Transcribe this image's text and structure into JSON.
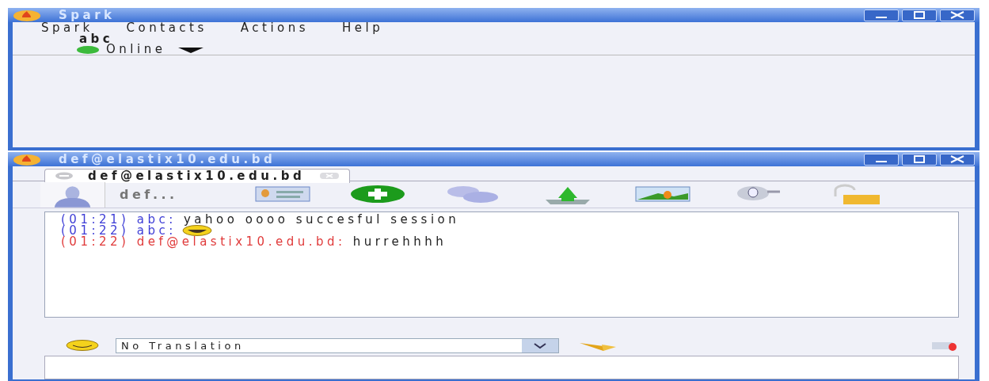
{
  "main_window": {
    "title": "Spark",
    "menu": [
      "Spark",
      "Contacts",
      "Actions",
      "Help"
    ],
    "user": {
      "name": "abc",
      "status": "Online",
      "online": true
    }
  },
  "chat_window": {
    "title": "def@elastix10.edu.bd",
    "tabs": [
      {
        "label": "def@elastix10.edu.bd",
        "selected": true
      }
    ],
    "contact_name": "def...",
    "messages": [
      {
        "time": "(01:21)",
        "sender": "abc:",
        "text": "yahoo oooo  succesful session",
        "kind": "sent"
      },
      {
        "time": "(01:22)",
        "sender": "abc:",
        "kind": "smiley"
      },
      {
        "time": "(01:22)",
        "sender": "def@elastix10.edu.bd:",
        "text": "hurrehhhh",
        "kind": "received"
      }
    ],
    "translation": {
      "value": "No Translation"
    }
  }
}
